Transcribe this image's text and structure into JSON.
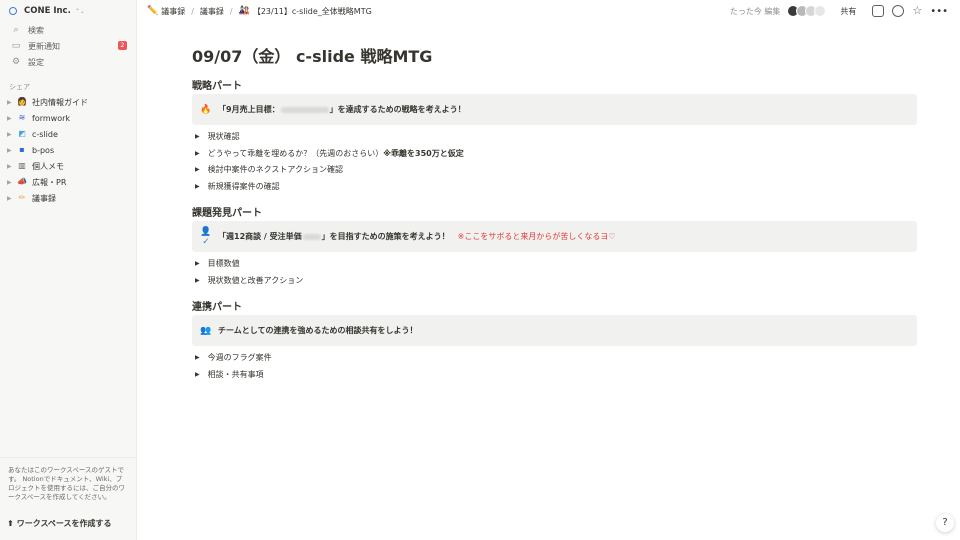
{
  "sidebar": {
    "workspace": "CONE Inc.",
    "nav": [
      {
        "label": "検索",
        "icon": "search-icon",
        "glyph": "⌕"
      },
      {
        "label": "更新通知",
        "icon": "inbox-icon",
        "glyph": "▭",
        "badge": "2"
      },
      {
        "label": "設定",
        "icon": "gear-icon",
        "glyph": "⚙"
      }
    ],
    "section_label": "シェア",
    "pages": [
      {
        "label": "社内情報ガイド",
        "icon": "guide-emoji-icon",
        "glyph": "👩",
        "color": "#f7b0b0"
      },
      {
        "label": "formwork",
        "icon": "formwork-logo-icon",
        "glyph": "≋",
        "color": "#3b5bdb"
      },
      {
        "label": "c-slide",
        "icon": "c-slide-logo-icon",
        "glyph": "◩",
        "color": "#4aa3df"
      },
      {
        "label": "b-pos",
        "icon": "b-pos-logo-icon",
        "glyph": "▪",
        "color": "#2d6bd6"
      },
      {
        "label": "個人メモ",
        "icon": "notebook-icon",
        "glyph": "▥",
        "color": "#5b5b5b"
      },
      {
        "label": "広報・PR",
        "icon": "megaphone-icon",
        "glyph": "📣",
        "color": "#e0a030"
      },
      {
        "label": "議事録",
        "icon": "pencil-icon",
        "glyph": "✏",
        "color": "#e8a040"
      }
    ],
    "guest_note": "あなたはこのワークスペースのゲストです。 Notionでドキュメント、Wiki、プロジェクトを使用するには、ご自分のワークスペースを作成してください。",
    "create_workspace": "ワークスペースを作成する"
  },
  "topbar": {
    "breadcrumbs": [
      {
        "label": "議事録",
        "glyph": "✏️"
      },
      {
        "label": "議事録",
        "glyph": ""
      },
      {
        "label": "【23/11】c-slide_全体戦略MTG",
        "glyph": "🎎"
      }
    ],
    "edited": "たった今 編集",
    "share": "共有",
    "avatar_colors": [
      "#3a3a3a",
      "#b9b9b9",
      "#d6d6d6",
      "#e7e7e7"
    ]
  },
  "page": {
    "title": "09/07（金） c-slide 戦略MTG",
    "sections": [
      {
        "heading": "戦略パート",
        "callout_icon": "fire-icon",
        "callout_glyph": "🔥",
        "callout_prefix": "「9月売上目標：",
        "callout_suffix": "」を達成するための戦略を考えよう！",
        "toggles": [
          {
            "text": "現状確認"
          },
          {
            "text": "どうやって乖離を埋めるか？（先週のおさらい）",
            "bold": "※乖離を350万と仮定"
          },
          {
            "text": "検討中案件のネクストアクション確認"
          },
          {
            "text": "新規獲得案件の確認"
          }
        ]
      },
      {
        "heading": "課題発見パート",
        "callout_icon": "person-check-icon",
        "callout_glyph": "👤✓",
        "callout_prefix": "「週12商談 / 受注単価",
        "callout_suffix": "」を目指すための施策を考えよう！",
        "callout_note": "※ここをサボると来月からが苦しくなるヨ♡",
        "toggles": [
          {
            "text": "目標数値"
          },
          {
            "text": "現状数値と改善アクション"
          }
        ]
      },
      {
        "heading": "連携パート",
        "callout_icon": "people-icon",
        "callout_glyph": "👥",
        "callout_text": "チームとしての連携を強めるための相談共有をしよう！",
        "toggles": [
          {
            "text": "今週のフラグ案件"
          },
          {
            "text": "相談・共有事項"
          }
        ]
      }
    ]
  },
  "help": "?"
}
